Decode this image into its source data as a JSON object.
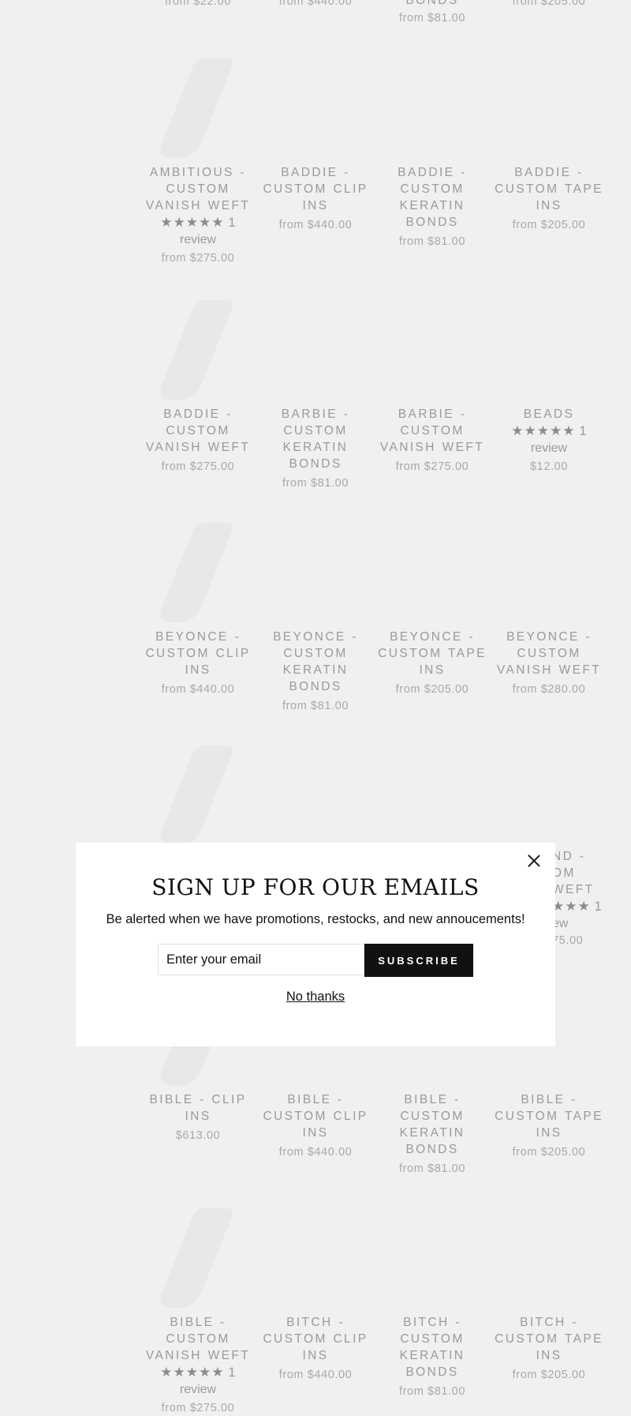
{
  "top_cut": [
    {
      "price": "from $22.00"
    },
    {
      "price": "from $440.00"
    },
    {
      "title": "BONDS",
      "price": "from $81.00"
    },
    {
      "price": "from $205.00"
    }
  ],
  "products": [
    {
      "title": "AMBITIOUS - CUSTOM VANISH WEFT",
      "stars": "★★★★★",
      "review_count": "1",
      "review_label": "review",
      "price": "from $275.00"
    },
    {
      "title": "BADDIE - CUSTOM CLIP INS",
      "price": "from $440.00"
    },
    {
      "title": "BADDIE - CUSTOM KERATIN BONDS",
      "price": "from $81.00"
    },
    {
      "title": "BADDIE - CUSTOM TAPE INS",
      "price": "from $205.00"
    },
    {
      "title": "BADDIE - CUSTOM VANISH WEFT",
      "price": "from $275.00"
    },
    {
      "title": "BARBIE - CUSTOM KERATIN BONDS",
      "price": "from $81.00"
    },
    {
      "title": "BARBIE - CUSTOM VANISH WEFT",
      "price": "from $275.00"
    },
    {
      "title": "BEADS",
      "stars": "★★★★★",
      "review_count": "1",
      "review_label": "review",
      "price": "$12.00"
    },
    {
      "title": "BEYONCE - CUSTOM CLIP INS",
      "price": "from $440.00"
    },
    {
      "title": "BEYONCE - CUSTOM KERATIN BONDS",
      "price": "from $81.00"
    },
    {
      "title": "BEYONCE - CUSTOM TAPE INS",
      "price": "from $205.00"
    },
    {
      "title": "BEYONCE - CUSTOM VANISH WEFT",
      "price": "from $280.00"
    },
    {
      "title": "ND -",
      "title2": "OM",
      "title3": "WEFT",
      "stars": "★★★",
      "review_count": "1",
      "review_label": "ew",
      "price": "75.00"
    },
    {
      "title": "BIBLE - CLIP INS",
      "price": "$613.00"
    },
    {
      "title": "BIBLE - CUSTOM CLIP INS",
      "price": "from $440.00"
    },
    {
      "title": "BIBLE - CUSTOM KERATIN BONDS",
      "price": "from $81.00"
    },
    {
      "title": "BIBLE - CUSTOM TAPE INS",
      "price": "from $205.00"
    },
    {
      "title": "BIBLE - CUSTOM VANISH WEFT",
      "stars": "★★★★★",
      "review_count": "1",
      "review_label": "review",
      "price": "from $275.00"
    },
    {
      "title": "BITCH - CUSTOM CLIP INS",
      "price": "from $440.00"
    },
    {
      "title": "BITCH - CUSTOM KERATIN BONDS",
      "price": "from $81.00"
    },
    {
      "title": "BITCH - CUSTOM TAPE INS",
      "price": "from $205.00"
    }
  ],
  "popup": {
    "title": "SIGN UP FOR OUR EMAILS",
    "subtitle": "Be alerted when we have promotions, restocks, and new annoucements!",
    "email_placeholder": "Enter your email",
    "subscribe_label": "SUBSCRIBE",
    "no_thanks_label": "No thanks",
    "close_icon": "close-icon"
  }
}
